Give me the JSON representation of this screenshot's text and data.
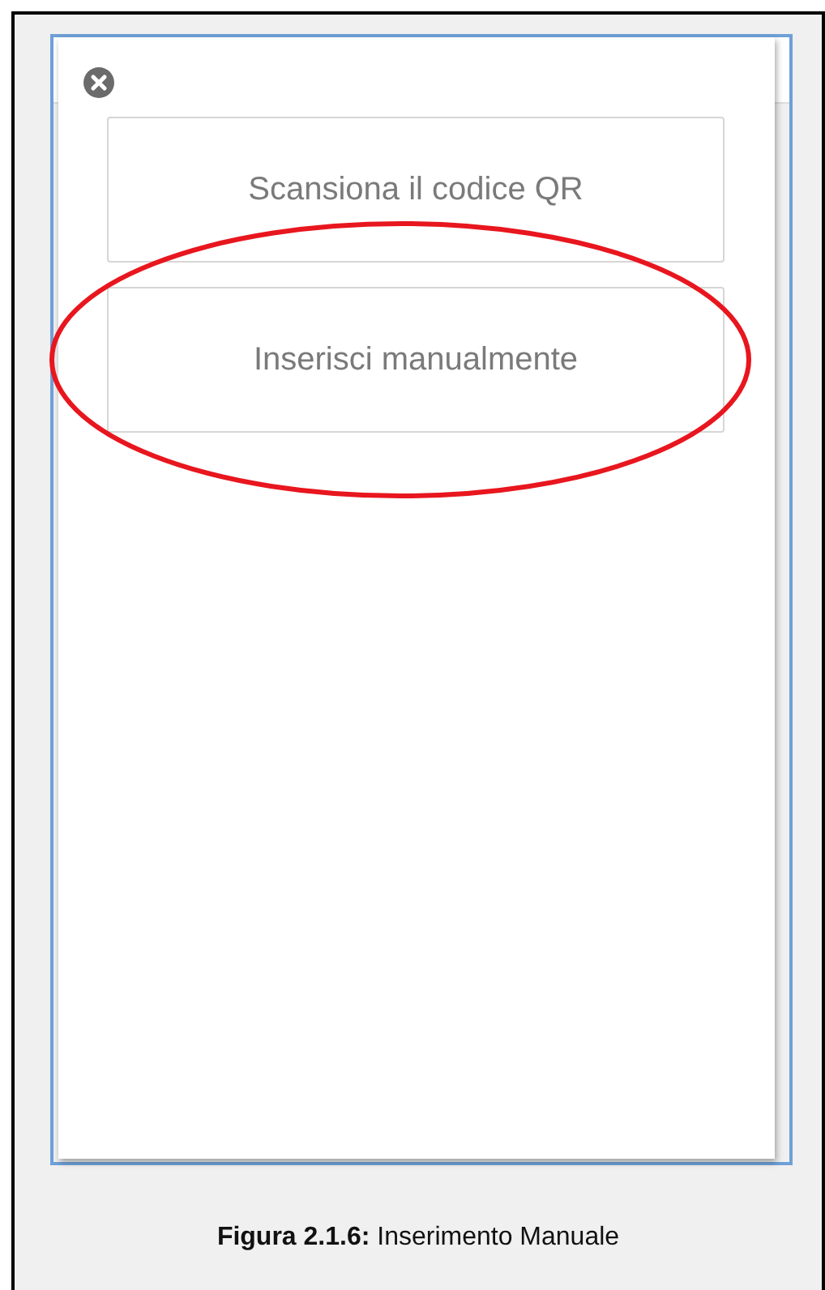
{
  "screen": {
    "buttons": [
      {
        "label": "Scansiona il codice QR",
        "highlighted": false
      },
      {
        "label": "Inserisci manualmente",
        "highlighted": true
      }
    ]
  },
  "caption": "**Figura 2.1.6:** Inserimento Manuale"
}
